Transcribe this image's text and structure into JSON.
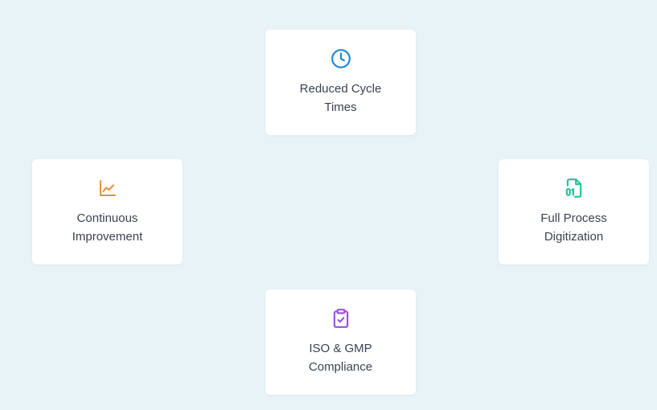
{
  "cards": [
    {
      "id": "reduced-cycle-times",
      "label": "Reduced Cycle Times",
      "icon": "clock-icon",
      "color": "#1f86d8"
    },
    {
      "id": "continuous-improvement",
      "label": "Continuous Improvement",
      "icon": "line-chart-icon",
      "color": "#e8903a"
    },
    {
      "id": "full-process-digitization",
      "label": "Full Process Digitization",
      "icon": "binary-file-icon",
      "color": "#1fc59a"
    },
    {
      "id": "iso-gmp-compliance",
      "label": "ISO & GMP Compliance",
      "icon": "clipboard-check-icon",
      "color": "#9b52d9"
    }
  ],
  "colors": {
    "background": "#e8f3f8",
    "card": "#ffffff",
    "text": "#3a4250"
  }
}
